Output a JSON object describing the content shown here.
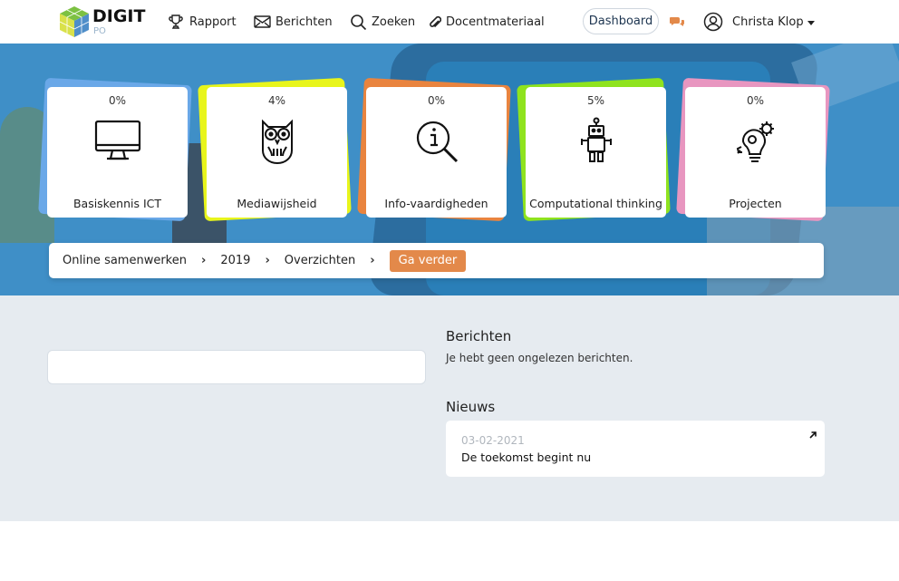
{
  "brand": {
    "name": "DIGIT",
    "sub": "PO"
  },
  "nav": {
    "items": [
      {
        "label": "Rapport",
        "icon": "trophy-icon"
      },
      {
        "label": "Berichten",
        "icon": "envelope-icon"
      },
      {
        "label": "Zoeken",
        "icon": "search-icon"
      },
      {
        "label": "Docentmateriaal",
        "icon": "paperclip-icon"
      }
    ],
    "dashboard_label": "Dashboard",
    "user_name": "Christa Klop"
  },
  "cards": [
    {
      "percent": "0%",
      "label": "Basiskennis ICT",
      "icon": "monitor-icon",
      "accent": "#6aa8e8"
    },
    {
      "percent": "4%",
      "label": "Mediawijsheid",
      "icon": "owl-icon",
      "accent": "#e8f51c"
    },
    {
      "percent": "0%",
      "label": "Info-vaardigheden",
      "icon": "info-search-icon",
      "accent": "#e9843f"
    },
    {
      "percent": "5%",
      "label": "Computational thinking",
      "icon": "robot-icon",
      "accent": "#8fe31e"
    },
    {
      "percent": "0%",
      "label": "Projecten",
      "icon": "gears-bulb-icon",
      "accent": "#e896c0"
    }
  ],
  "breadcrumb": {
    "items": [
      "Online samenwerken",
      "2019",
      "Overzichten"
    ],
    "action_label": "Ga verder",
    "action_color": "#e3894a"
  },
  "messages": {
    "heading": "Berichten",
    "text": "Je hebt geen ongelezen berichten."
  },
  "news": {
    "heading": "Nieuws",
    "items": [
      {
        "date": "03-02-2021",
        "title": "De toekomst begint nu"
      }
    ]
  }
}
